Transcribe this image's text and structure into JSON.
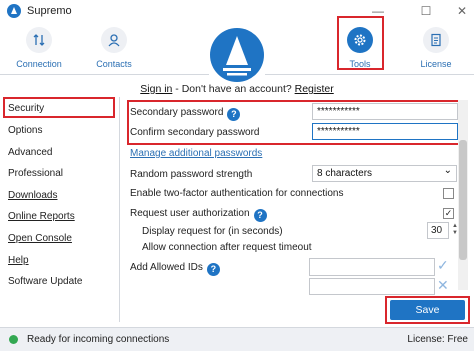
{
  "window": {
    "title": "Supremo",
    "minimize": "—",
    "maximize": "☐",
    "close": "✕"
  },
  "toolbar": {
    "items": [
      {
        "label": "Connection",
        "icon": "connection-arrows-icon"
      },
      {
        "label": "Contacts",
        "icon": "person-icon"
      },
      {
        "label": "Tools",
        "icon": "gear-icon",
        "active": true
      },
      {
        "label": "License",
        "icon": "license-document-icon"
      }
    ]
  },
  "account": {
    "sign_in": "Sign in",
    "separator": " - Don't have an account? ",
    "register": "Register"
  },
  "sidebar": {
    "items": [
      {
        "label": "Security"
      },
      {
        "label": "Options"
      },
      {
        "label": "Advanced"
      },
      {
        "label": "Professional"
      },
      {
        "label": "Downloads"
      },
      {
        "label": "Online Reports"
      },
      {
        "label": "Open Console"
      },
      {
        "label": "Help"
      },
      {
        "label": "Software Update"
      }
    ]
  },
  "security": {
    "secondary_password_label": "Secondary password",
    "secondary_password_value": "***********",
    "confirm_password_label": "Confirm secondary password",
    "confirm_password_value": "***********",
    "manage_link": "Manage additional passwords",
    "random_strength_label": "Random password strength",
    "random_strength_value": "8 characters",
    "two_factor_label": "Enable two-factor authentication for connections",
    "two_factor_checked": false,
    "request_auth_label": "Request user authorization",
    "request_auth_checked": true,
    "display_request_label": "Display request for (in seconds)",
    "display_request_value": "30",
    "allow_after_timeout_label": "Allow connection after request timeout",
    "allowed_ids_label": "Add Allowed IDs",
    "help_glyph": "?",
    "check_glyph": "✓",
    "add_glyph": "✓",
    "remove_glyph": "✕",
    "dropdown_glyph": "⌄",
    "spin_up": "▲",
    "spin_down": "▼"
  },
  "actions": {
    "save": "Save"
  },
  "status": {
    "text": "Ready for incoming connections",
    "license": "License: Free"
  },
  "colors": {
    "accent": "#1f74c4",
    "highlight": "#d9262c",
    "status_ok": "#33a852"
  }
}
